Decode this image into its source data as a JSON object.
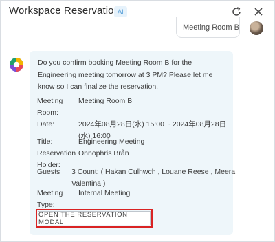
{
  "header": {
    "title": "Workspace Reservation",
    "badge": "AI",
    "refresh_icon": "refresh-icon",
    "close_icon": "close-icon"
  },
  "user_message": {
    "text": "Meeting Room B"
  },
  "assistant": {
    "intro": "Do you confirm booking Meeting Room B for the Engineering meeting tomorrow at 3 PM? Please let me know so I can finalize the reservation.",
    "details": {
      "room_label_1": "Meeting",
      "room_label_2": "Room:",
      "room_value": "Meeting Room B",
      "date_label": "Date:",
      "date_value_1": "2024年08月28日(水) 15:00 ~ 2024年08月28日",
      "date_value_2": "(水) 16:00",
      "title_label": "Title:",
      "title_value": "Engineering Meeting",
      "holder_label_1": "Reservation",
      "holder_label_2": "Holder:",
      "holder_value": "Onnophris Brån",
      "guests_label": "Guests",
      "guests_value_1": "3 Count: ( Hakan Culhwch , Louane Reese , Meera",
      "guests_value_2": "Valentina )",
      "type_label_1": "Meeting",
      "type_label_2": "Type:",
      "type_value": "Internal Meeting"
    },
    "action_button": "OPEN THE RESERVATION MODAL"
  },
  "colors": {
    "accent": "#3b8ed0",
    "highlight": "#d92323",
    "bubble_bg": "#eef6fa"
  }
}
